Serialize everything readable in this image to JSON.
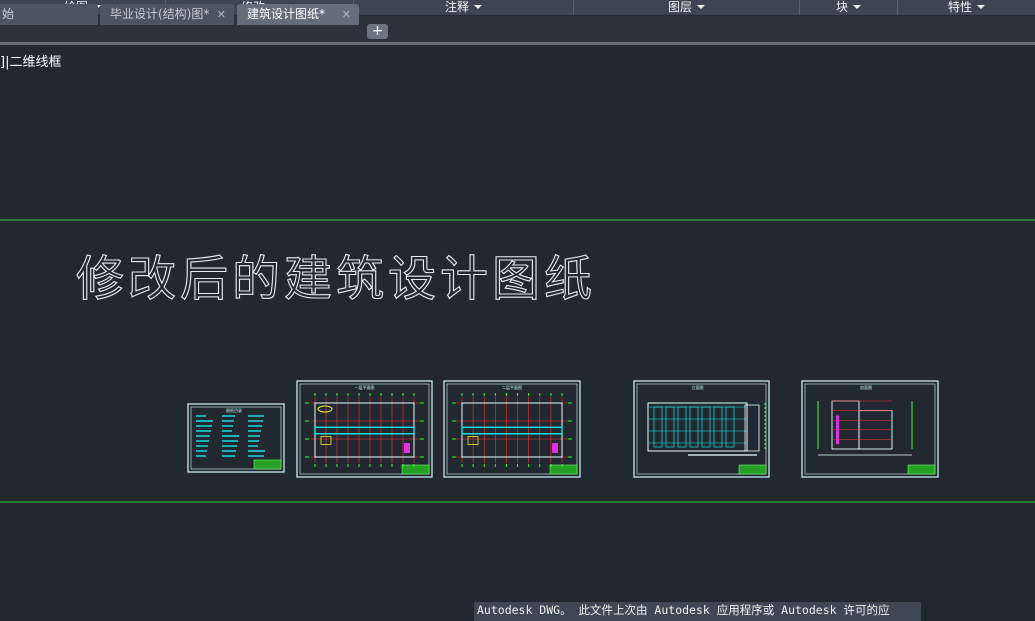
{
  "ribbon": {
    "panels": [
      {
        "label": "绘图"
      },
      {
        "label": "修改"
      },
      {
        "label": "注释"
      },
      {
        "label": "图层"
      },
      {
        "label": "块"
      },
      {
        "label": "特性"
      }
    ]
  },
  "tabs": [
    {
      "label": "始",
      "active": false,
      "closable": false
    },
    {
      "label": "毕业设计(结构)图*",
      "active": false,
      "closable": true
    },
    {
      "label": "建筑设计图纸*",
      "active": true,
      "closable": true
    }
  ],
  "tab_add": "+",
  "tab_close": "✕",
  "viewport_controls": "]|二维线框",
  "drawing": {
    "heading": "修改后的建筑设计图纸",
    "line_color": "#2fd12f",
    "text_color": "#e8ecf0",
    "sheet_border_color": "#d8f6ff",
    "sheet_line_color": "#19e6e6",
    "sheet_titles": [
      "图纸目录",
      "一层平面图",
      "二层平面图",
      "立面图",
      "剖面图"
    ]
  },
  "notice": "Autodesk DWG。 此文件上次由 Autodesk 应用程序或 Autodesk 许可的应"
}
